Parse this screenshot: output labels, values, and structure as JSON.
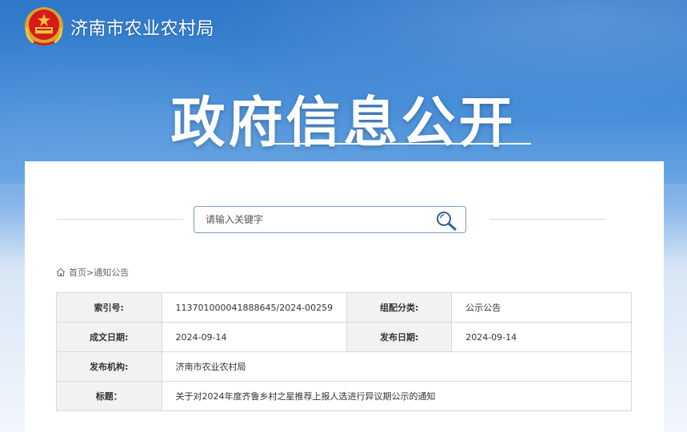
{
  "header": {
    "site_name": "济南市农业农村局",
    "emblem_icon": "national-emblem-icon"
  },
  "hero": {
    "title": "政府信息公开"
  },
  "search": {
    "placeholder": "请输入关键字",
    "button_icon": "search-icon"
  },
  "breadcrumb": {
    "home_icon": "home-icon",
    "home": "首页",
    "separator": ">",
    "current": "通知公告"
  },
  "info": {
    "index_label": "索引号:",
    "index_value": "11370100004188864​5/2024-00259",
    "category_label": "组配分类:",
    "category_value": "公示公告",
    "date_label": "成文日期:",
    "date_value": "2024-09-14",
    "publish_label": "发布日期:",
    "publish_value": "2024-09-14",
    "agency_label": "发布机构:",
    "agency_value": "济南市农业农村局",
    "title_label": "标题：",
    "title_value": "关于对2024年度齐鲁乡村之星推荐上报人选进行异议期公示的通知"
  },
  "colors": {
    "header_blue": "#3f89d6",
    "border": "#d9d9d9",
    "label_bg": "#f2f2f2"
  }
}
